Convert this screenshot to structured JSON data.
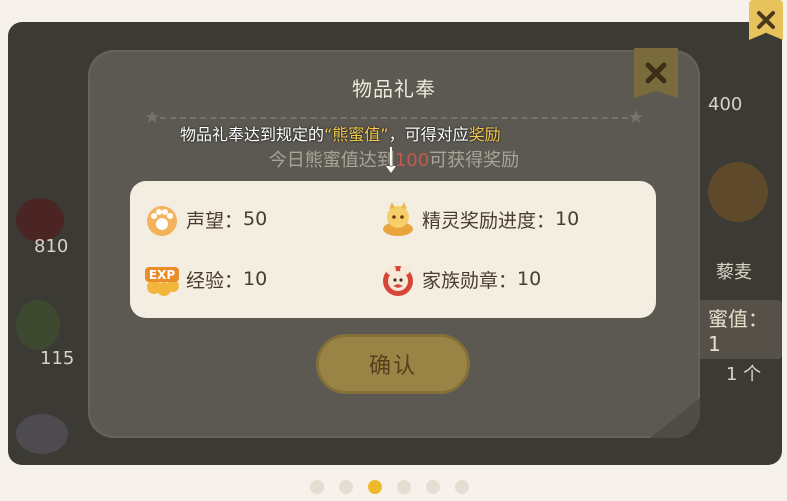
{
  "dialog": {
    "title": "物品礼奉",
    "hint": {
      "prefix": "物品礼奉达到规定的",
      "highlight1": "“熊蜜值”",
      "middle": "，可得对应",
      "highlight2": "奖励"
    },
    "subtitle": {
      "prefix": "今日熊蜜值达到",
      "value": "100",
      "suffix": "可获得奖励"
    },
    "rewards": [
      {
        "icon": "paw-icon",
        "label": "声望：",
        "value": "50"
      },
      {
        "icon": "spirit-icon",
        "label": "精灵奖励进度：",
        "value": "10"
      },
      {
        "icon": "exp-icon",
        "label": "经验：",
        "value": "10"
      },
      {
        "icon": "family-medal-icon",
        "label": "家族勋章：",
        "value": "10"
      }
    ],
    "confirm_label": "确认"
  },
  "background": {
    "texts": [
      "400",
      "810",
      "115",
      "藜麦",
      "蜜值：1",
      "1 个"
    ]
  },
  "pager": {
    "count": 6,
    "active_index": 2
  },
  "colors": {
    "accent": "#f0b92a",
    "highlight": "#f3c94e",
    "value_red": "#c25b4a"
  }
}
